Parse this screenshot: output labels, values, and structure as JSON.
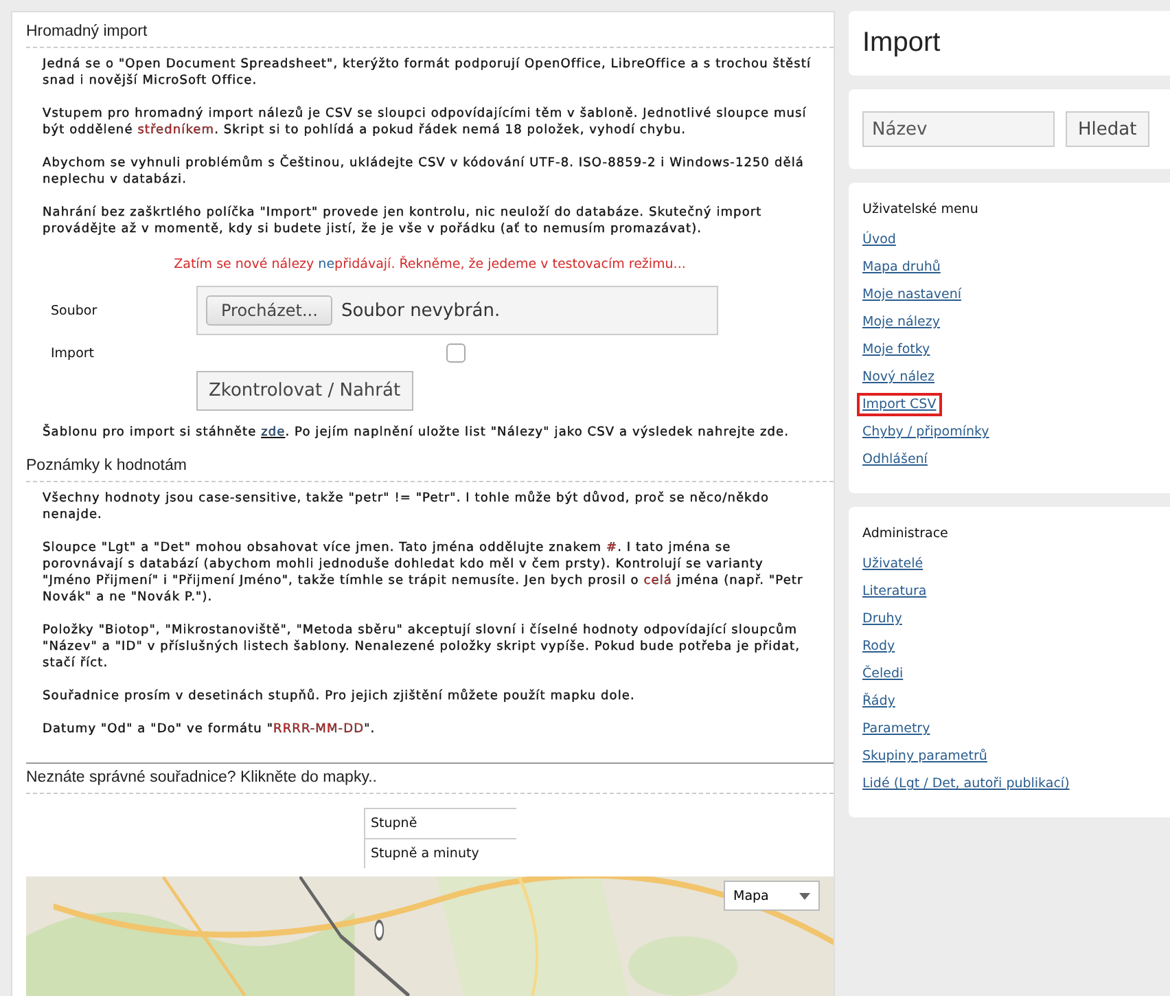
{
  "main": {
    "section_title": "Hromadný import",
    "intro": [
      [
        {
          "kind": "text",
          "text": "Jedná se o \"Open Document Spreadsheet\", kterýžto formát podporují OpenOffice, LibreOffice a s trochou štěstí snad i novější MicroSoft Office."
        }
      ],
      [
        {
          "kind": "text",
          "text": "Vstupem pro hromadný import nálezů je CSV se sloupci odpovídajícími těm v šabloně. Jednotlivé sloupce musí být oddělené "
        },
        {
          "kind": "red",
          "text": "středníkem"
        },
        {
          "kind": "text",
          "text": ". Skript si to pohlídá a pokud řádek nemá 18 položek, vyhodí chybu."
        }
      ],
      [
        {
          "kind": "text",
          "text": "Abychom se vyhnuli problémům s Češtinou, ukládejte CSV v kódování UTF-8. ISO-8859-2 i Windows-1250 dělá neplechu v databázi."
        }
      ],
      [
        {
          "kind": "text",
          "text": "Nahrání bez zaškrtlého políčka \"Import\" provede jen kontrolu, nic neuloží do databáze. Skutečný import provádějte až v momentě, kdy si budete jistí, že je vše v pořádku (ať to nemusím promazávat)."
        }
      ]
    ],
    "warning": [
      {
        "kind": "red",
        "text": "Zatím se nové nálezy "
      },
      {
        "kind": "blue",
        "text": "ne"
      },
      {
        "kind": "red",
        "text": "přidávají. Řekněme, že jedeme v testovacím režimu..."
      }
    ],
    "form": {
      "file_label": "Soubor",
      "browse_button": "Procházet...",
      "file_status": "Soubor nevybrán.",
      "import_label": "Import",
      "import_checked": false,
      "submit_button": "Zkontrolovat / Nahrát"
    },
    "template_note": [
      {
        "kind": "text",
        "text": "Šablonu pro import si stáhněte "
      },
      {
        "kind": "link",
        "text": "zde"
      },
      {
        "kind": "text",
        "text": ". Po jejím naplnění uložte list \"Nálezy\" jako CSV a výsledek nahrejte zde."
      }
    ],
    "notes_title": "Poznámky k hodnotám",
    "notes": [
      [
        {
          "kind": "text",
          "text": "Všechny hodnoty jsou case-sensitive, takže \"petr\" != \"Petr\". I tohle může být důvod, proč se něco/někdo nenajde."
        }
      ],
      [
        {
          "kind": "text",
          "text": "Sloupce \"Lgt\" a \"Det\" mohou obsahovat více jmen. Tato jména oddělujte znakem "
        },
        {
          "kind": "red",
          "text": "#"
        },
        {
          "kind": "text",
          "text": ". I tato jména se porovnávají s databází (abychom mohli jednoduše dohledat kdo měl v čem prsty). Kontrolují se varianty \"Jméno Přijmení\" i \"Přijmení Jméno\", takže tímhle se trápit nemusíte. Jen bych prosil o "
        },
        {
          "kind": "red",
          "text": "celá"
        },
        {
          "kind": "text",
          "text": " jména (např. \"Petr Novák\" a ne \"Novák P.\")."
        }
      ],
      [
        {
          "kind": "text",
          "text": "Položky \"Biotop\", \"Mikrostanoviště\", \"Metoda sběru\" akceptují slovní i číselné hodnoty odpovídající sloupcům \"Název\" a \"ID\" v příslušných listech šablony. Nenalezené položky skript vypíše. Pokud bude potřeba je přidat, stačí říct."
        }
      ],
      [
        {
          "kind": "text",
          "text": "Souřadnice prosím v desetinách stupňů. Pro jejich zjištění můžete použít mapku dole."
        }
      ],
      [
        {
          "kind": "text",
          "text": "Datumy \"Od\" a \"Do\" ve formátu \""
        },
        {
          "kind": "red",
          "text": "RRRR-MM-DD"
        },
        {
          "kind": "text",
          "text": "\"."
        }
      ]
    ],
    "map_title": "Neznáte správné souřadnice? Klikněte do mapky..",
    "coord_formats": [
      "Stupně",
      "Stupně a minuty"
    ],
    "map": {
      "kind": "picture",
      "type_control": "Mapa"
    }
  },
  "sidebar": {
    "title": "Import",
    "search_placeholder": "Název",
    "search_button": "Hledat",
    "menus": [
      {
        "title": "Uživatelské menu",
        "items": [
          {
            "label": "Úvod",
            "selected": false
          },
          {
            "label": "Mapa druhů",
            "selected": false
          },
          {
            "label": "Moje nastavení",
            "selected": false
          },
          {
            "label": "Moje nálezy",
            "selected": false
          },
          {
            "label": "Moje fotky",
            "selected": false
          },
          {
            "label": "Nový nález",
            "selected": false
          },
          {
            "label": "Import CSV",
            "selected": true
          },
          {
            "label": "Chyby / připomínky",
            "selected": false
          },
          {
            "label": "Odhlášení",
            "selected": false
          }
        ]
      },
      {
        "title": "Administrace",
        "items": [
          {
            "label": "Uživatelé",
            "selected": false
          },
          {
            "label": "Literatura",
            "selected": false
          },
          {
            "label": "Druhy",
            "selected": false
          },
          {
            "label": "Rody",
            "selected": false
          },
          {
            "label": "Čeledi",
            "selected": false
          },
          {
            "label": "Řády",
            "selected": false
          },
          {
            "label": "Parametry",
            "selected": false
          },
          {
            "label": "Skupiny parametrů",
            "selected": false
          },
          {
            "label": "Lidé (Lgt / Det, autoři publikací)",
            "selected": false
          }
        ]
      }
    ]
  }
}
